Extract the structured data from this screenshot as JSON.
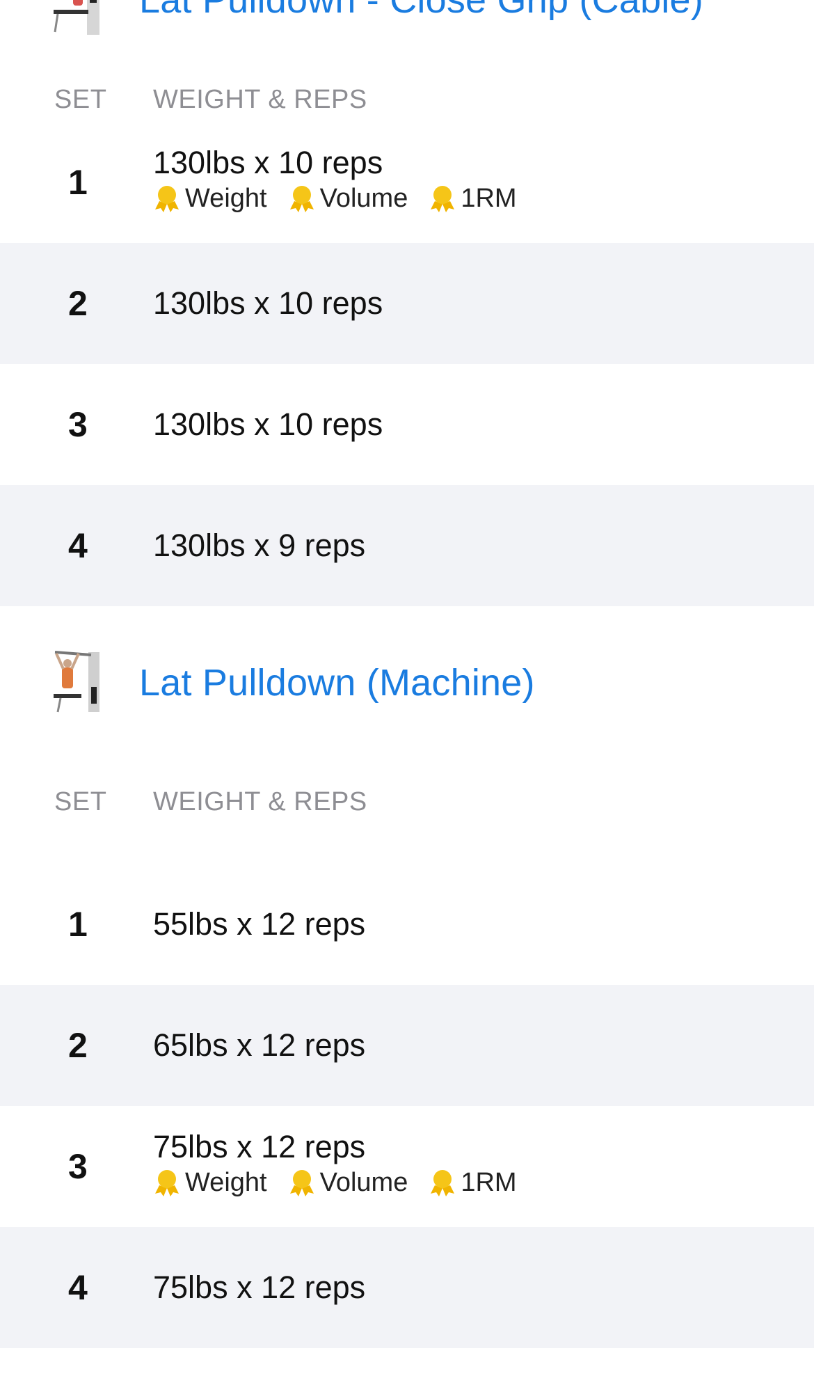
{
  "colors": {
    "accent": "#1a7ce0",
    "alt_row": "#f2f3f7",
    "muted": "#8e8e93",
    "medal": "#f5c518"
  },
  "exercises": [
    {
      "title": "Lat Pulldown - Close Grip (Cable)",
      "thumbnail_icon": "lat-pulldown-cable-icon",
      "col_set": "SET",
      "col_weight_reps": "WEIGHT & REPS",
      "sets": [
        {
          "num": "1",
          "text": "130lbs x 10 reps",
          "badges": [
            "Weight",
            "Volume",
            "1RM"
          ]
        },
        {
          "num": "2",
          "text": "130lbs x 10 reps"
        },
        {
          "num": "3",
          "text": "130lbs x 10 reps"
        },
        {
          "num": "4",
          "text": "130lbs x 9 reps"
        }
      ]
    },
    {
      "title": "Lat Pulldown (Machine)",
      "thumbnail_icon": "lat-pulldown-machine-icon",
      "col_set": "SET",
      "col_weight_reps": "WEIGHT & REPS",
      "sets": [
        {
          "num": "1",
          "text": "55lbs x 12 reps"
        },
        {
          "num": "2",
          "text": "65lbs x 12 reps"
        },
        {
          "num": "3",
          "text": "75lbs x 12 reps",
          "badges": [
            "Weight",
            "Volume",
            "1RM"
          ]
        },
        {
          "num": "4",
          "text": "75lbs x 12 reps"
        }
      ]
    }
  ]
}
